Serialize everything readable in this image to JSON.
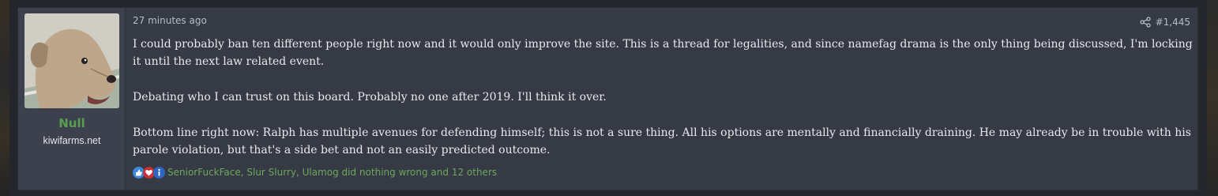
{
  "post": {
    "timestamp": "27 minutes ago",
    "post_number": "#1,445",
    "paragraphs": [
      "I could probably ban ten different people right now and it would only improve the site. This is a thread for legalities, and since namefag drama is the only thing being discussed, I'm locking it until the next law related event.",
      "Debating who I can trust on this board. Probably no one after 2019. I'll think it over.",
      "Bottom line right now: Ralph has multiple avenues for defending himself; this is not a sure thing. All his options are mentally and financially draining. He may already be in trouble with his parole violation, but that's a side bet and not an easily predicted outcome."
    ],
    "reactions_text": "SeniorFuckFace, Slur Slurry, Ulamog did nothing wrong and 12 others",
    "reaction_icons": [
      "like-icon",
      "love-icon",
      "informative-icon"
    ]
  },
  "user": {
    "name": "Null",
    "title": "kiwifarms.net",
    "avatar": "dog-avatar"
  },
  "colors": {
    "username": "#5a9e52",
    "reactions_text": "#6ea85c",
    "post_bg": "#353a45",
    "user_cell_bg": "#3c414d"
  }
}
